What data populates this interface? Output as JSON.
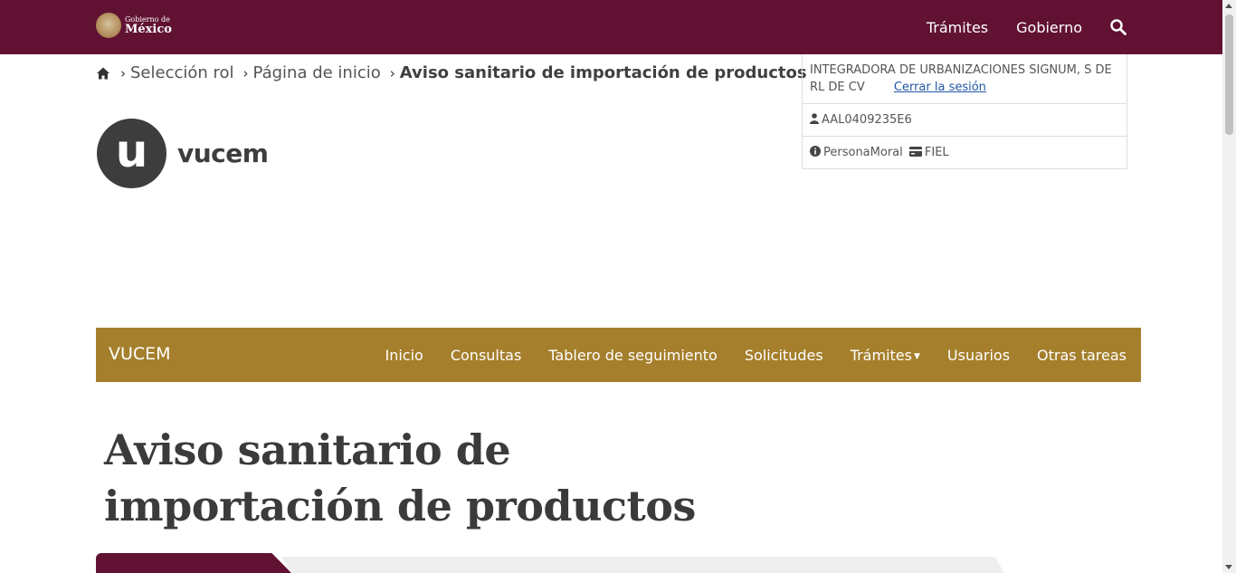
{
  "header": {
    "logo_line1": "Gobierno de",
    "logo_line2": "México",
    "nav": [
      "Trámites",
      "Gobierno"
    ],
    "search_icon": "search-icon",
    "background": "#611232"
  },
  "breadcrumb": {
    "items": [
      "Selección rol",
      "Página de inicio"
    ],
    "current": "Aviso sanitario de importación de productos"
  },
  "user": {
    "company": "INTEGRADORA DE URBANIZACIONES SIGNUM, S DE RL DE CV",
    "logout_label": "Cerrar la sesión",
    "rfc": "AAL0409235E6",
    "person_type": "PersonaMoral",
    "signature_type": "FIEL"
  },
  "vucem_logo": {
    "letter": "u",
    "word": "vucem"
  },
  "main_nav": {
    "brand": "VUCEM",
    "background": "#a57f2c",
    "items": [
      "Inicio",
      "Consultas",
      "Tablero de seguimiento",
      "Solicitudes",
      "Trámites",
      "Usuarios",
      "Otras tareas"
    ]
  },
  "page": {
    "title_line1": "Aviso sanitario de",
    "title_line2": "importación de productos"
  }
}
